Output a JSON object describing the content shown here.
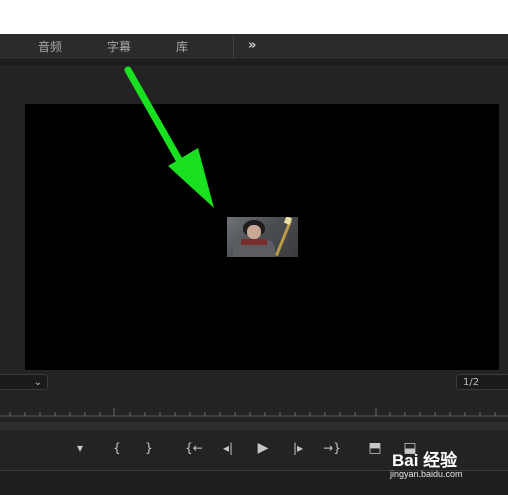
{
  "tabs": {
    "audio": "音频",
    "captions": "字幕",
    "library": "库",
    "more": "»"
  },
  "program_monitor": {
    "resolution": "1/2",
    "zoom_chevron": "⌄"
  },
  "annotation": {
    "arrow_color": "#19e11f"
  },
  "transport": {
    "add_marker": "▾",
    "mark_in": "{",
    "mark_out": "}",
    "go_to_in": "{←",
    "step_back": "◂|",
    "play": "▶",
    "step_forward": "|▸",
    "go_to_out": "→}",
    "lift": "⬒",
    "extract": "⬓"
  },
  "watermark": {
    "brand": "Bai 经验",
    "url": "jingyan.baidu.com"
  }
}
